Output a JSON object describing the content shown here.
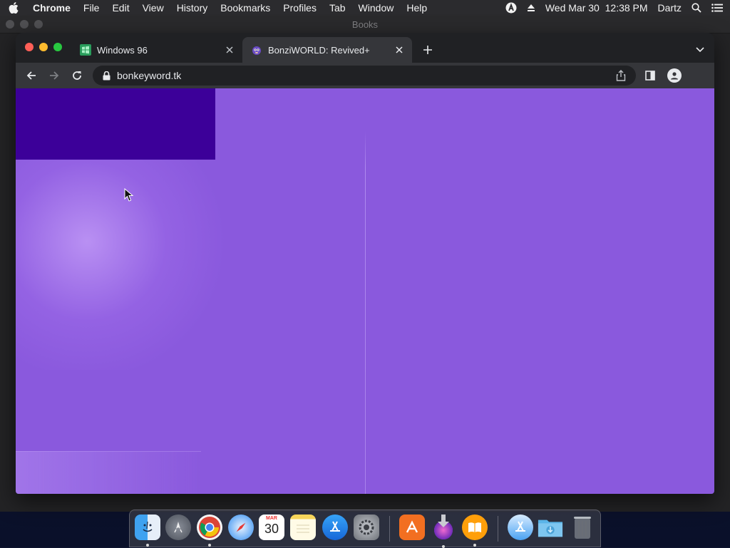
{
  "menubar": {
    "app_name": "Chrome",
    "items": [
      "File",
      "Edit",
      "View",
      "History",
      "Bookmarks",
      "Profiles",
      "Tab",
      "Window",
      "Help"
    ],
    "datetime": "Wed Mar 30  12:38 PM",
    "user": "Dartz"
  },
  "background_window": {
    "title": "Books"
  },
  "browser": {
    "tabs": [
      {
        "title": "Windows 96",
        "favicon": "windows96-icon",
        "active": false
      },
      {
        "title": "BonziWORLD: Revived+",
        "favicon": "bonzi-icon",
        "active": true
      }
    ],
    "url": "bonkeyword.tk"
  },
  "page": {
    "background_color": "#8a59dd",
    "block_color": "#3c0099"
  },
  "dock": {
    "calendar_month": "MAR",
    "calendar_day": "30",
    "apps": [
      "finder-icon",
      "launchpad-icon",
      "chrome-icon",
      "safari-icon",
      "calendar-icon",
      "notes-icon",
      "app-store-icon",
      "system-preferences-icon",
      "avast-icon",
      "installer-icon",
      "books-icon",
      "app-store-folder-icon",
      "downloads-folder-icon",
      "trash-icon"
    ]
  }
}
